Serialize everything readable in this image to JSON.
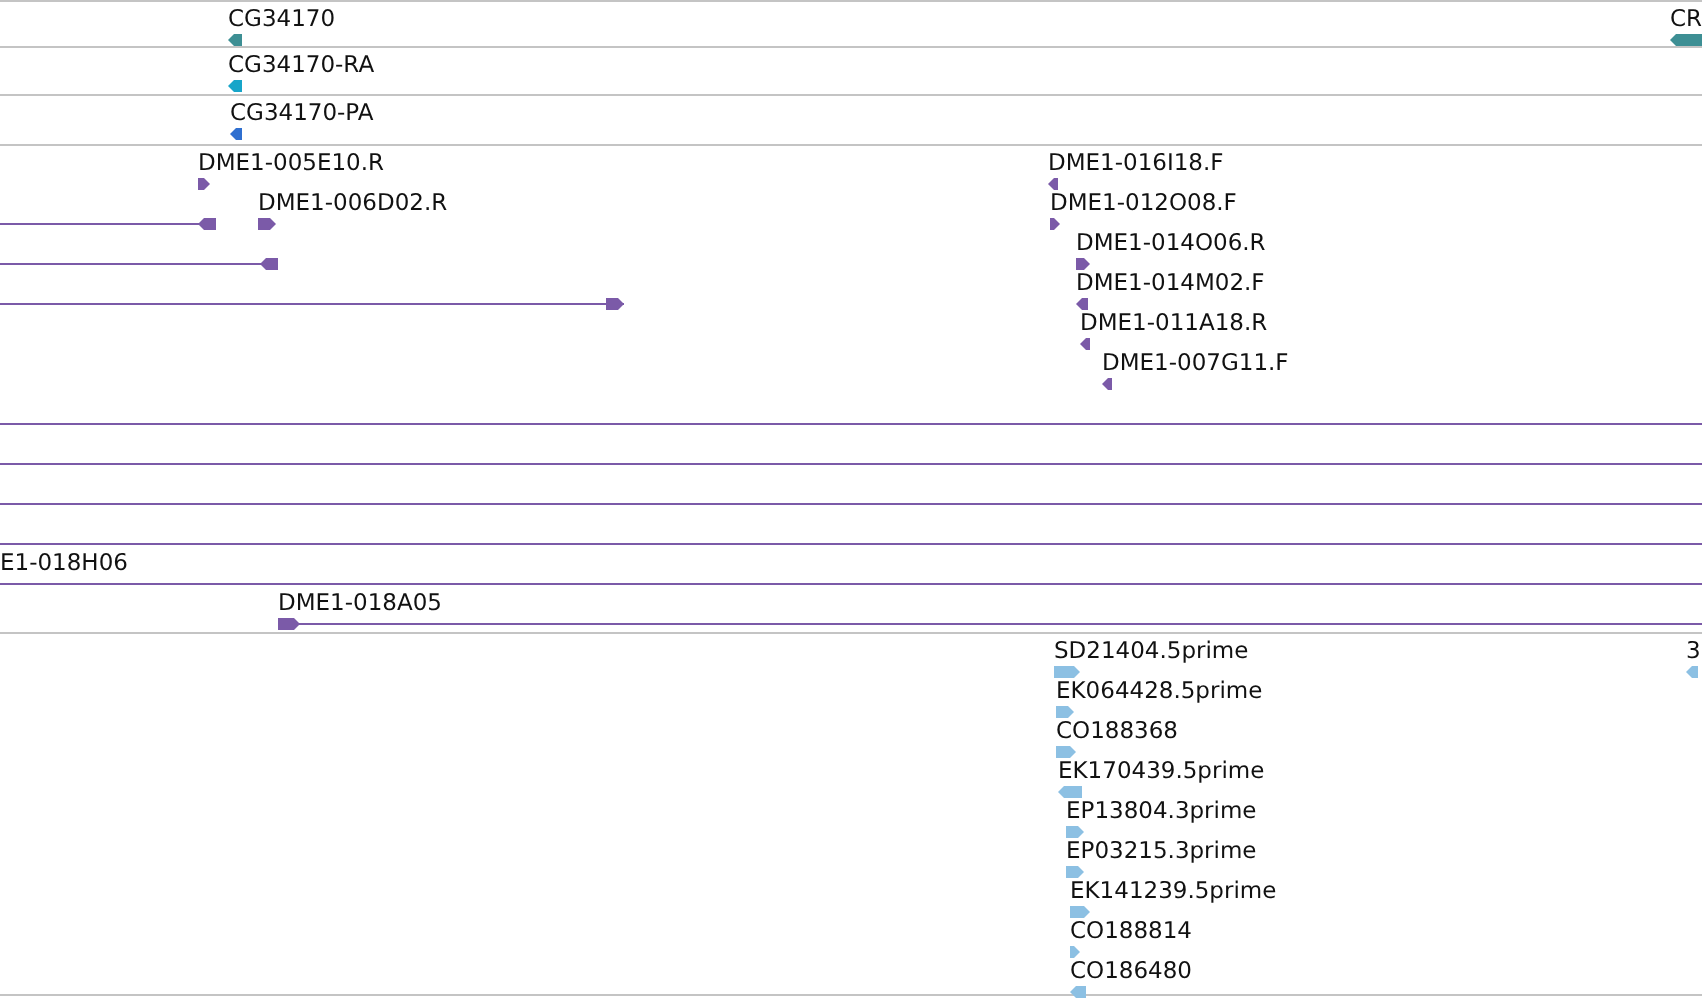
{
  "tracks": [
    {
      "color": "#3d8f94",
      "features": [
        {
          "kind": "arrow",
          "label": "CG34170",
          "reverse": true
        },
        {
          "kind": "arrow",
          "label": "CR",
          "reverse": true
        }
      ]
    },
    {
      "color": "#17a5c9",
      "features": [
        {
          "kind": "arrow",
          "label": "CG34170-RA",
          "reverse": true
        }
      ]
    },
    {
      "color": "#2f6fd0",
      "features": [
        {
          "kind": "arrow",
          "label": "CG34170-PA",
          "reverse": true
        }
      ]
    },
    {
      "color": "#7b5aa8",
      "features": [
        {
          "kind": "arrow",
          "label": "DME1-005E10.R",
          "reverse": false
        },
        {
          "kind": "arrow",
          "label": "DME1-016I18.F",
          "reverse": true
        },
        {
          "kind": "arrow",
          "label": "DME1-006D02.R",
          "reverse": false
        },
        {
          "kind": "span",
          "reverse": true
        },
        {
          "kind": "arrow",
          "label": "DME1-012O08.F",
          "reverse": false
        },
        {
          "kind": "span",
          "reverse": true
        },
        {
          "kind": "arrow",
          "label": "DME1-014O06.R",
          "reverse": false
        },
        {
          "kind": "span",
          "reverse": false
        },
        {
          "kind": "arrow",
          "label": "DME1-014M02.F",
          "reverse": true
        },
        {
          "kind": "arrow",
          "label": "DME1-011A18.R",
          "reverse": true
        },
        {
          "kind": "arrow",
          "label": "DME1-007G11.F",
          "reverse": true
        },
        {
          "kind": "line"
        },
        {
          "kind": "line"
        },
        {
          "kind": "line"
        },
        {
          "kind": "line"
        },
        {
          "kind": "line",
          "label": "E1-018H06"
        },
        {
          "kind": "span",
          "label": "DME1-018A05",
          "reverse": false
        }
      ]
    },
    {
      "color": "#8cc0e3",
      "features": [
        {
          "kind": "arrow",
          "label": "SD21404.5prime",
          "reverse": false
        },
        {
          "kind": "arrow",
          "label": "3",
          "reverse": true
        },
        {
          "kind": "arrow",
          "label": "EK064428.5prime",
          "reverse": false
        },
        {
          "kind": "arrow",
          "label": "CO188368",
          "reverse": false
        },
        {
          "kind": "arrow",
          "label": "EK170439.5prime",
          "reverse": true
        },
        {
          "kind": "arrow",
          "label": "EP13804.3prime",
          "reverse": false
        },
        {
          "kind": "arrow",
          "label": "EP03215.3prime",
          "reverse": false
        },
        {
          "kind": "arrow",
          "label": "EK141239.5prime",
          "reverse": false
        },
        {
          "kind": "arrow",
          "label": "CO188814",
          "reverse": false
        },
        {
          "kind": "arrow",
          "label": "CO186480",
          "reverse": true
        }
      ]
    }
  ]
}
